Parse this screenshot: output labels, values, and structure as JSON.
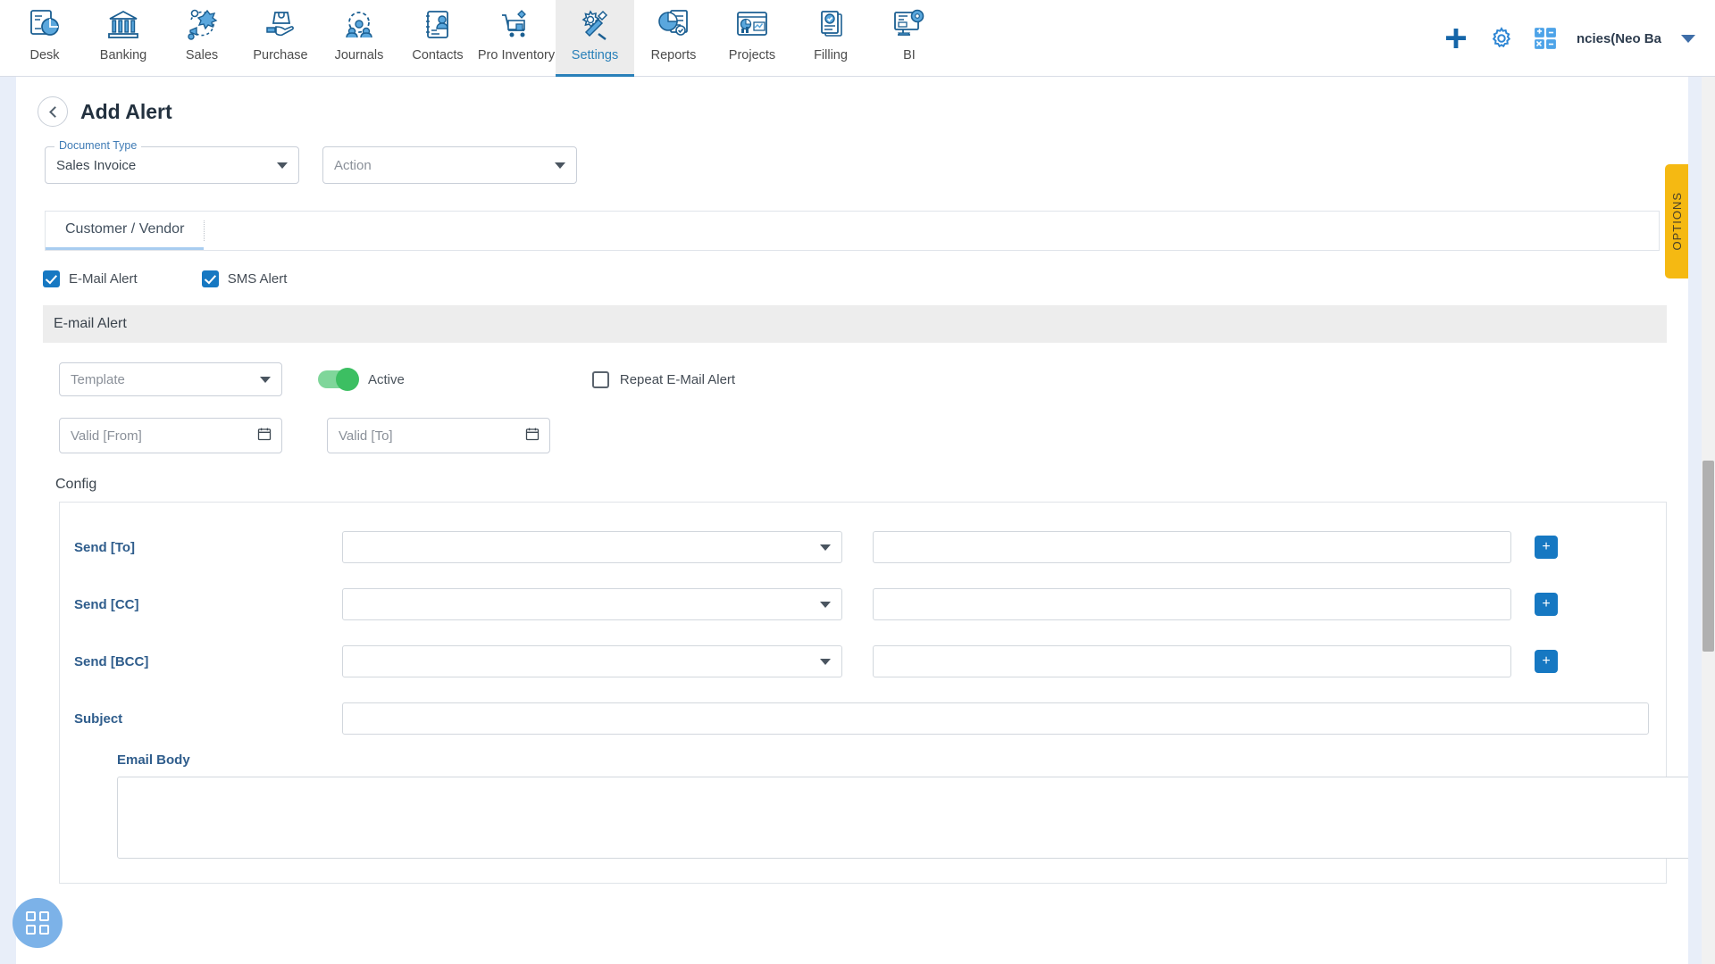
{
  "topnav": {
    "items": [
      {
        "label": "Desk",
        "icon": "dashboard-icon",
        "active": false
      },
      {
        "label": "Banking",
        "icon": "bank-icon",
        "active": false
      },
      {
        "label": "Sales",
        "icon": "sales-icon",
        "active": false
      },
      {
        "label": "Purchase",
        "icon": "purchase-icon",
        "active": false
      },
      {
        "label": "Journals",
        "icon": "journals-icon",
        "active": false
      },
      {
        "label": "Contacts",
        "icon": "contacts-icon",
        "active": false
      },
      {
        "label": "Pro Inventory",
        "icon": "inventory-icon",
        "active": false
      },
      {
        "label": "Settings",
        "icon": "settings-icon",
        "active": true
      },
      {
        "label": "Reports",
        "icon": "reports-icon",
        "active": false
      },
      {
        "label": "Projects",
        "icon": "projects-icon",
        "active": false
      },
      {
        "label": "Filling",
        "icon": "filling-icon",
        "active": false
      },
      {
        "label": "BI",
        "icon": "bi-icon",
        "active": false
      }
    ],
    "add_icon": "plus-icon",
    "settings_icon": "gear-icon",
    "calculator_icon": "calculator-icon",
    "company": "ncies(Neo Ba",
    "company_chevron": "chevron-down-icon"
  },
  "header": {
    "back_icon": "chevron-left-icon",
    "title": "Add Alert"
  },
  "form": {
    "document_type": {
      "label": "Document Type",
      "value": "Sales Invoice",
      "caret": "caret-down-icon"
    },
    "action": {
      "placeholder": "Action",
      "caret": "caret-down-icon"
    }
  },
  "tabs": [
    {
      "label": "Customer / Vendor",
      "active": true
    }
  ],
  "alert_types": [
    {
      "label": "E-Mail Alert",
      "checked": true
    },
    {
      "label": "SMS Alert",
      "checked": true
    }
  ],
  "email_section": {
    "title": "E-mail Alert",
    "template": {
      "placeholder": "Template",
      "caret": "caret-down-icon"
    },
    "active_toggle": {
      "label": "Active",
      "on": true
    },
    "repeat": {
      "label": "Repeat E-Mail Alert",
      "checked": false
    },
    "valid_from": {
      "placeholder": "Valid [From]",
      "value": "",
      "icon": "calendar-icon"
    },
    "valid_to": {
      "placeholder": "Valid [To]",
      "value": "",
      "icon": "calendar-icon"
    }
  },
  "config": {
    "title": "Config",
    "rows": [
      {
        "label": "Send [To]",
        "select_value": "",
        "input_value": "",
        "add_label": "+"
      },
      {
        "label": "Send [CC]",
        "select_value": "",
        "input_value": "",
        "add_label": "+"
      },
      {
        "label": "Send [BCC]",
        "select_value": "",
        "input_value": "",
        "add_label": "+"
      }
    ],
    "subject": {
      "label": "Subject",
      "value": ""
    },
    "email_body": {
      "label": "Email Body",
      "value": ""
    }
  },
  "options_tab": {
    "label": "OPTIONS"
  },
  "fab": {
    "icon": "grid-apps-icon"
  },
  "colors": {
    "accent_blue": "#1678c2",
    "label_blue": "#2f5d8c",
    "toggle_green": "#3cbf62",
    "options_amber": "#f5b912",
    "page_bg": "#e8eef9"
  }
}
